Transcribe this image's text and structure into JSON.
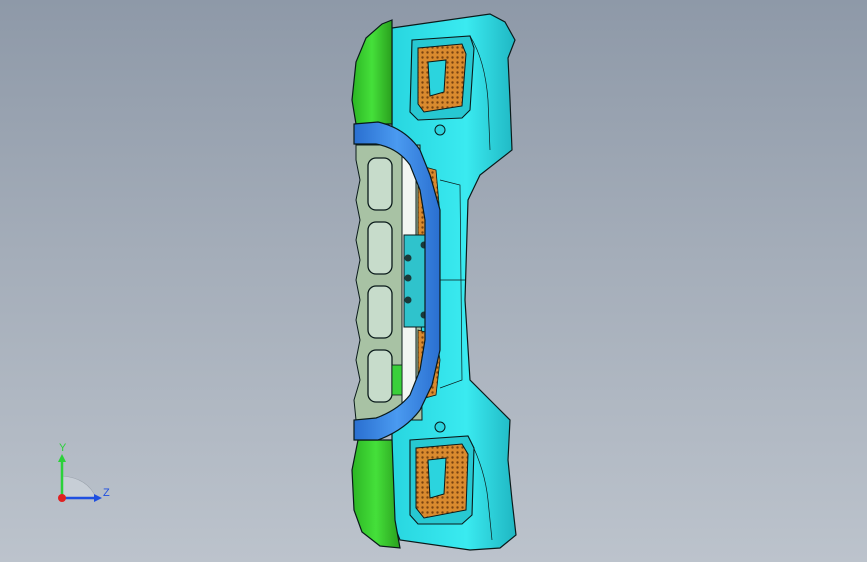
{
  "viewport": {
    "background_top": "#8e99a8",
    "background_bottom": "#bcc3cc"
  },
  "model": {
    "colors": {
      "body": "#2fe0e8",
      "body_shadow": "#1fb9c4",
      "end_caps": "#33d12a",
      "bar": "#2f7fe0",
      "mesh": "#d98a2e",
      "grille": "#a8c2a4",
      "edge": "#0a1a1a"
    }
  },
  "triad": {
    "y_label": "Y",
    "z_label": "Z",
    "y_color": "#2bd13a",
    "z_color": "#1f4fe0",
    "x_color": "#e02020"
  }
}
